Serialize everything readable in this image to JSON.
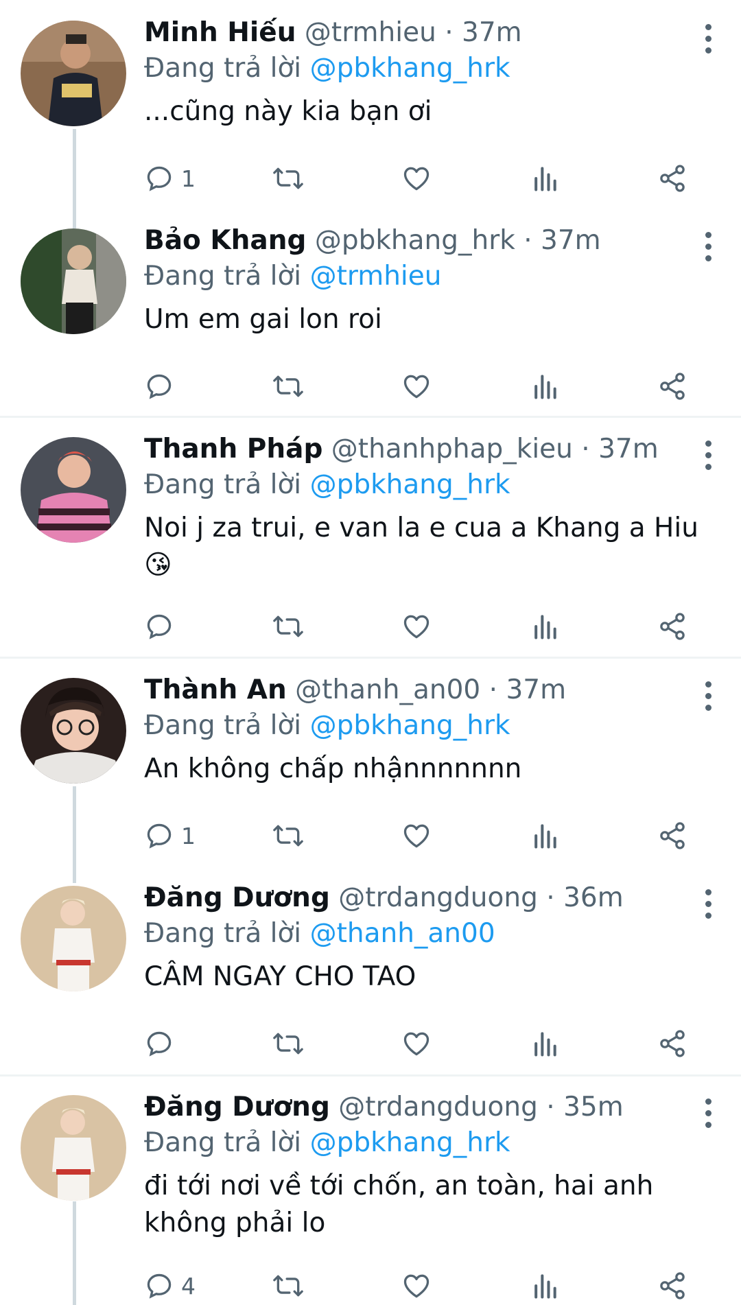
{
  "reply_prefix": "Đang trả lời",
  "tweets": [
    {
      "name": "Minh Hiếu",
      "handle": "@trmhieu",
      "time": "37m",
      "reply_to": "@pbkhang_hrk",
      "text_lines": [
        "...cũng này kia bạn ơi"
      ],
      "replies": "1",
      "avatar_colors": {
        "bg": "#8a6a4e",
        "skin": "#c99a7a",
        "shirt": "#1f2430"
      }
    },
    {
      "name": "Bảo Khang",
      "handle": "@pbkhang_hrk",
      "time": "37m",
      "reply_to": "@trmhieu",
      "text_lines": [
        "Um em gai lon roi"
      ],
      "replies": "",
      "avatar_colors": {
        "bg": "#5e6a5a",
        "skin": "#d8b89b",
        "shirt": "#ece6dc"
      }
    },
    {
      "name": "Thanh Pháp",
      "handle": "@thanhphap_kieu",
      "time": "37m",
      "reply_to": "@pbkhang_hrk",
      "text_lines": [
        "Noi j za trui, e van la e cua a Khang a Hiu",
        "😘"
      ],
      "replies": "",
      "avatar_colors": {
        "bg": "#4a4e57",
        "skin": "#e8b9a0",
        "shirt": "#e583b3"
      }
    },
    {
      "name": "Thành An",
      "handle": "@thanh_an00",
      "time": "37m",
      "reply_to": "@pbkhang_hrk",
      "text_lines": [
        "An không chấp nhậnnnnnnn"
      ],
      "replies": "1",
      "avatar_colors": {
        "bg": "#2a1f1d",
        "skin": "#f0c9b4",
        "shirt": "#e8e6e3"
      }
    },
    {
      "name": "Đăng Dương",
      "handle": "@trdangduong",
      "time": "36m",
      "reply_to": "@thanh_an00",
      "text_lines": [
        "CÂM NGAY CHO TAO"
      ],
      "replies": "",
      "avatar_colors": {
        "bg": "#d9c3a4",
        "skin": "#f0d3bd",
        "shirt": "#f6f3ef"
      }
    },
    {
      "name": "Đăng Dương",
      "handle": "@trdangduong",
      "time": "35m",
      "reply_to": "@pbkhang_hrk",
      "text_lines": [
        "đi tới nơi về tới chốn, an toàn, hai anh",
        "không phải lo"
      ],
      "replies": "4",
      "avatar_colors": {
        "bg": "#d9c3a4",
        "skin": "#f0d3bd",
        "shirt": "#f6f3ef"
      }
    }
  ]
}
